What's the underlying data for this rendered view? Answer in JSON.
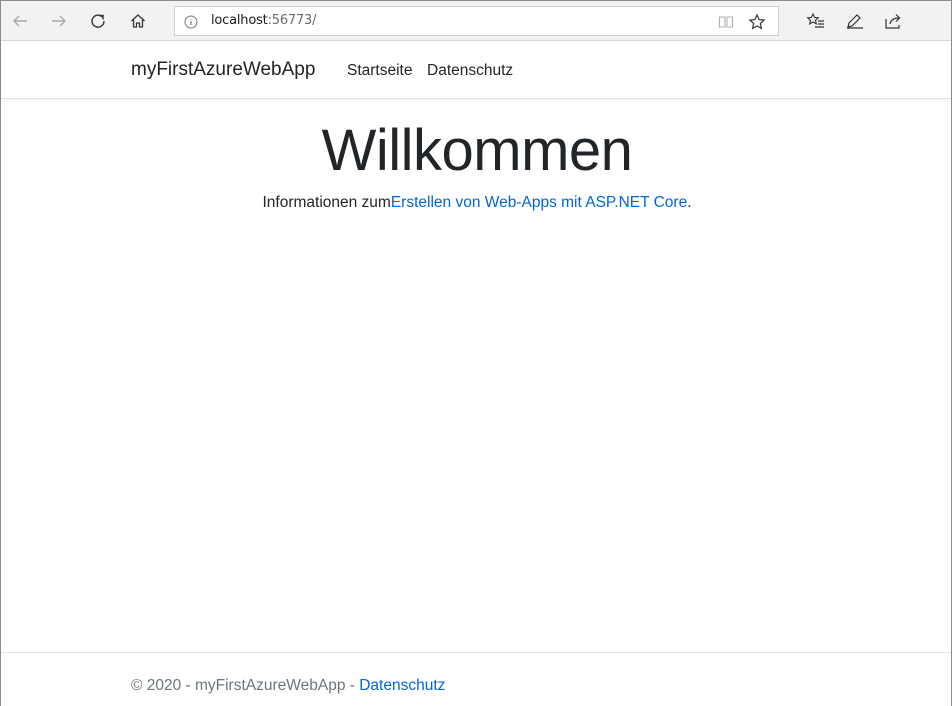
{
  "browser": {
    "url_host": "localhost",
    "url_rest": ":56773/",
    "icons": [
      "back-icon",
      "forward-icon",
      "refresh-icon",
      "home-icon",
      "info-icon",
      "reading-view-icon",
      "favorite-star-icon",
      "favorites-hub-icon",
      "annotate-pen-icon",
      "share-icon"
    ]
  },
  "navbar": {
    "brand": "myFirstAzureWebApp",
    "links": [
      "Startseite",
      "Datenschutz"
    ]
  },
  "main": {
    "title": "Willkommen",
    "text_prefix": "Informationen zum",
    "link_text": "Erstellen von Web-Apps mit ASP.NET Core",
    "text_suffix": "."
  },
  "footer": {
    "text": "© 2020 - myFirstAzureWebApp - ",
    "privacy_link": "Datenschutz"
  },
  "colors": {
    "link": "#0366d6",
    "text": "#212529",
    "muted": "#6c757d",
    "toolbar": "#f2f2f2"
  }
}
